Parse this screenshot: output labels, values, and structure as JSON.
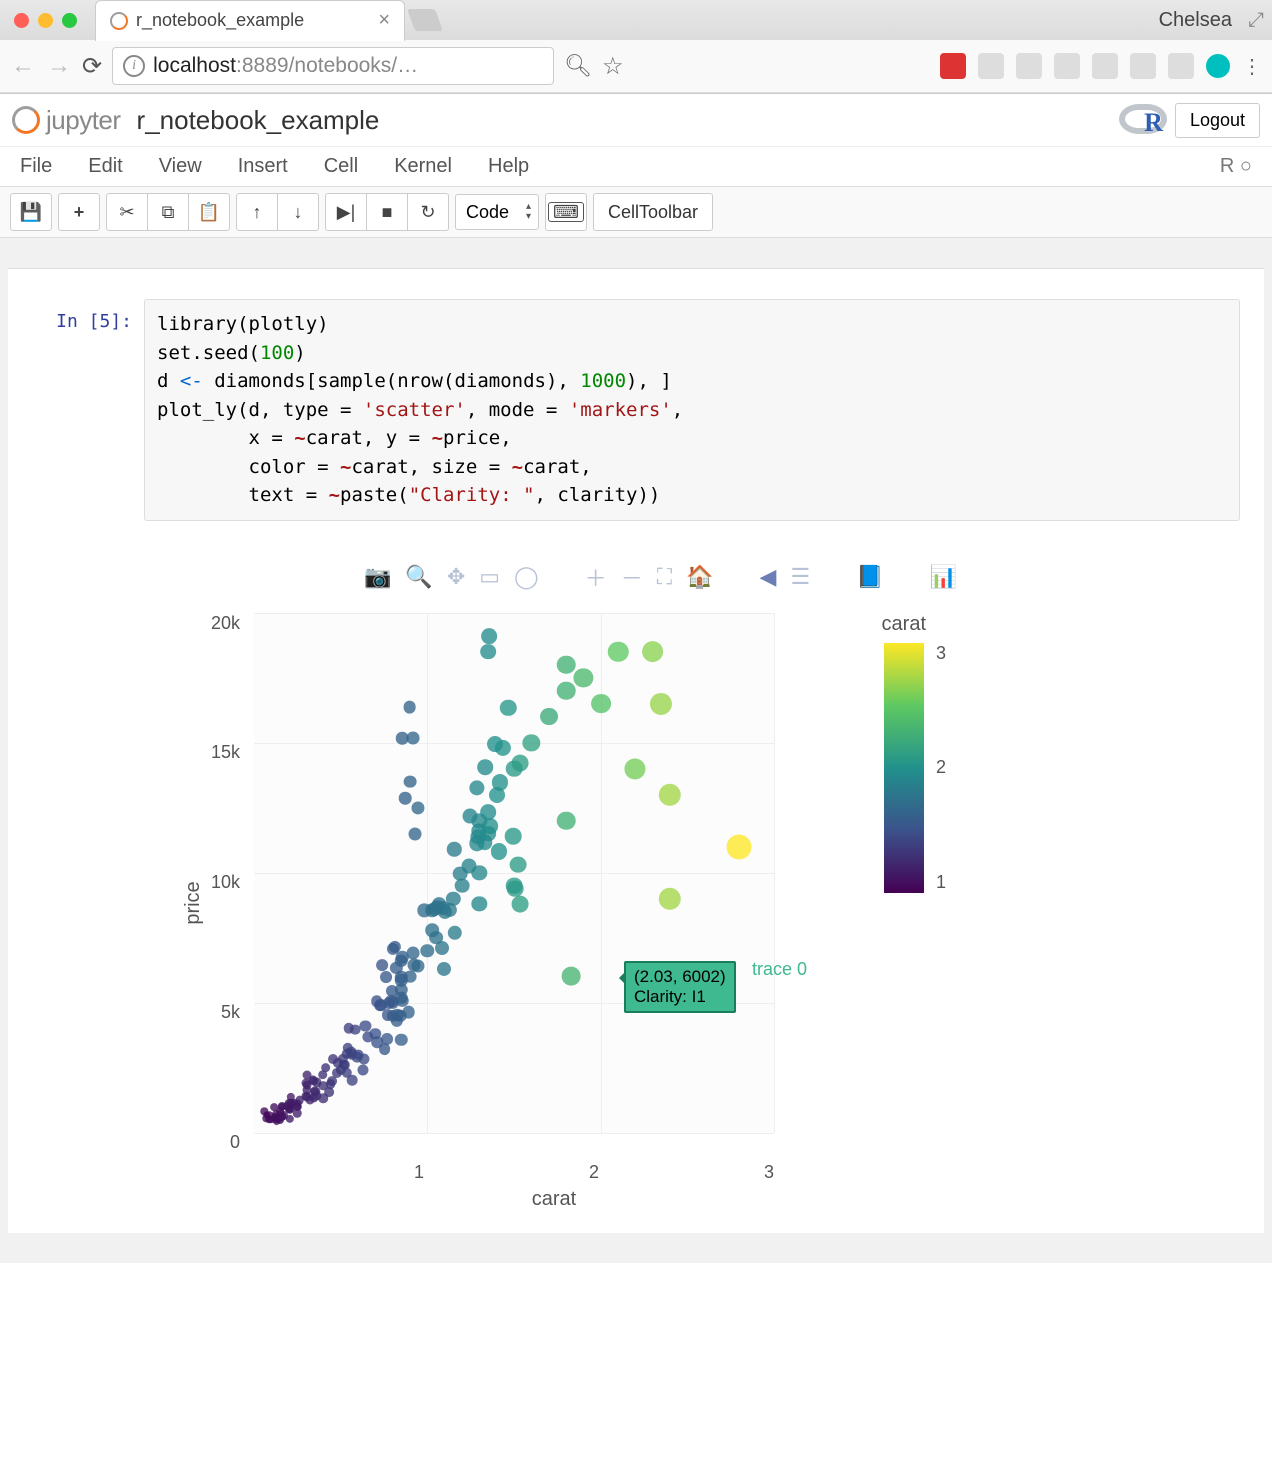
{
  "browser": {
    "user": "Chelsea",
    "tab_title": "r_notebook_example",
    "url_host": "localhost",
    "url_port": ":8889",
    "url_path": "/notebooks/…"
  },
  "jupyter": {
    "brand": "jupyter",
    "notebook_name": "r_notebook_example",
    "logout": "Logout",
    "kernel_indicator": "R"
  },
  "menu": {
    "file": "File",
    "edit": "Edit",
    "view": "View",
    "insert": "Insert",
    "cell": "Cell",
    "kernel": "Kernel",
    "help": "Help"
  },
  "toolbar": {
    "cell_type": "Code",
    "cell_toolbar": "CellToolbar"
  },
  "cell": {
    "prompt_prefix": "In [",
    "prompt_num": "5",
    "prompt_suffix": "]:",
    "code": {
      "line1a": "library(plotly)",
      "line2a": "set.seed(",
      "line2_num": "100",
      "line2b": ")",
      "line3a": "d ",
      "line3_arrow": "<-",
      "line3b": " diamonds[sample(nrow(diamonds), ",
      "line3_num": "1000",
      "line3c": "), ]",
      "line4a": "plot_ly(d, type = ",
      "line4_str1": "'scatter'",
      "line4b": ", mode = ",
      "line4_str2": "'markers'",
      "line4c": ",",
      "line5a": "        x = ",
      "line5_t1": "~",
      "line5b": "carat, y = ",
      "line5_t2": "~",
      "line5c": "price,",
      "line6a": "        color = ",
      "line6_t1": "~",
      "line6b": "carat, size = ",
      "line6_t2": "~",
      "line6c": "carat,",
      "line7a": "        text = ",
      "line7_t1": "~",
      "line7b": "paste(",
      "line7_str": "\"Clarity: \"",
      "line7c": ", clarity))"
    }
  },
  "plot": {
    "y_ticks": [
      "20k",
      "15k",
      "10k",
      "5k",
      "0"
    ],
    "y_title": "price",
    "x_ticks": [
      "1",
      "2",
      "3"
    ],
    "x_title": "carat",
    "colorbar_title": "carat",
    "colorbar_ticks": [
      "3",
      "2",
      "1"
    ],
    "tooltip_line1": "(2.03, 6002)",
    "tooltip_line2": "Clarity:  I1",
    "trace_label": "trace 0"
  },
  "chart_data": {
    "type": "scatter",
    "xlabel": "carat",
    "ylabel": "price",
    "xlim": [
      0.2,
      3.2
    ],
    "ylim": [
      0,
      20000
    ],
    "color_variable": "carat",
    "size_variable": "carat",
    "colorscale": "viridis",
    "hover_point": {
      "x": 2.03,
      "y": 6002,
      "text": "Clarity:  I1",
      "trace": "trace 0"
    },
    "series": [
      {
        "name": "trace 0",
        "x_approx": "0.2–3.0 carat",
        "y_approx": "300–19000 price",
        "n": 1000,
        "sample_points": [
          {
            "x": 0.3,
            "y": 500
          },
          {
            "x": 0.32,
            "y": 600
          },
          {
            "x": 0.35,
            "y": 700
          },
          {
            "x": 0.4,
            "y": 900
          },
          {
            "x": 0.45,
            "y": 1000
          },
          {
            "x": 0.5,
            "y": 1400
          },
          {
            "x": 0.55,
            "y": 1600
          },
          {
            "x": 0.6,
            "y": 1800
          },
          {
            "x": 0.7,
            "y": 2400
          },
          {
            "x": 0.72,
            "y": 2600
          },
          {
            "x": 0.8,
            "y": 3000
          },
          {
            "x": 0.9,
            "y": 3800
          },
          {
            "x": 1.0,
            "y": 4500
          },
          {
            "x": 1.0,
            "y": 5000
          },
          {
            "x": 1.05,
            "y": 5500
          },
          {
            "x": 1.1,
            "y": 6000
          },
          {
            "x": 1.1,
            "y": 13500
          },
          {
            "x": 1.2,
            "y": 7000
          },
          {
            "x": 1.25,
            "y": 7500
          },
          {
            "x": 1.3,
            "y": 8500
          },
          {
            "x": 1.35,
            "y": 9000
          },
          {
            "x": 1.4,
            "y": 9500
          },
          {
            "x": 1.5,
            "y": 10000
          },
          {
            "x": 1.5,
            "y": 12000
          },
          {
            "x": 1.55,
            "y": 11500
          },
          {
            "x": 1.55,
            "y": 18500
          },
          {
            "x": 1.6,
            "y": 13000
          },
          {
            "x": 1.7,
            "y": 14000
          },
          {
            "x": 1.7,
            "y": 9500
          },
          {
            "x": 1.8,
            "y": 15000
          },
          {
            "x": 1.9,
            "y": 16000
          },
          {
            "x": 2.0,
            "y": 17000
          },
          {
            "x": 2.0,
            "y": 18000
          },
          {
            "x": 2.0,
            "y": 12000
          },
          {
            "x": 2.03,
            "y": 6002
          },
          {
            "x": 2.1,
            "y": 17500
          },
          {
            "x": 2.2,
            "y": 16500
          },
          {
            "x": 2.3,
            "y": 18500
          },
          {
            "x": 2.4,
            "y": 14000
          },
          {
            "x": 2.5,
            "y": 18500
          },
          {
            "x": 2.55,
            "y": 16500
          },
          {
            "x": 2.6,
            "y": 13000
          },
          {
            "x": 2.6,
            "y": 9000
          },
          {
            "x": 3.0,
            "y": 11000
          }
        ]
      }
    ]
  }
}
